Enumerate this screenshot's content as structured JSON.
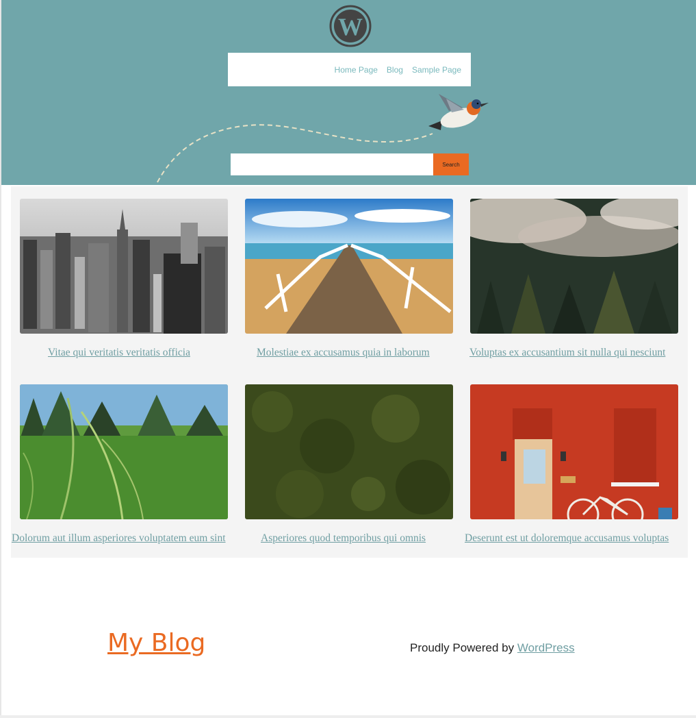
{
  "header": {
    "nav": [
      {
        "label": "Home Page"
      },
      {
        "label": "Blog"
      },
      {
        "label": "Sample Page"
      }
    ],
    "search": {
      "placeholder": "",
      "button_label": "Search"
    },
    "colors": {
      "background": "#70a6aa",
      "accent": "#ea6a22",
      "link": "#7ab9bd"
    }
  },
  "posts": [
    {
      "title": "Vitae qui veritatis veritatis officia",
      "image": "black-and-white city skyline"
    },
    {
      "title": "Molestiae ex accusamus quia in laborum",
      "image": "wooden pier over sea"
    },
    {
      "title": "Voluptas ex accusantium sit nulla qui nesciunt",
      "image": "foggy forest"
    },
    {
      "title": "Dolorum aut illum asperiores voluptatem eum sint",
      "image": "grass field close-up"
    },
    {
      "title": "Asperiores quod temporibus qui omnis",
      "image": "green moss texture"
    },
    {
      "title": "Deserunt est ut doloremque accusamus voluptas",
      "image": "red brick wall with door and bicycle"
    }
  ],
  "footer": {
    "site_title": "My Blog",
    "credit_prefix": "Proudly Powered by",
    "credit_link": "WordPress"
  }
}
